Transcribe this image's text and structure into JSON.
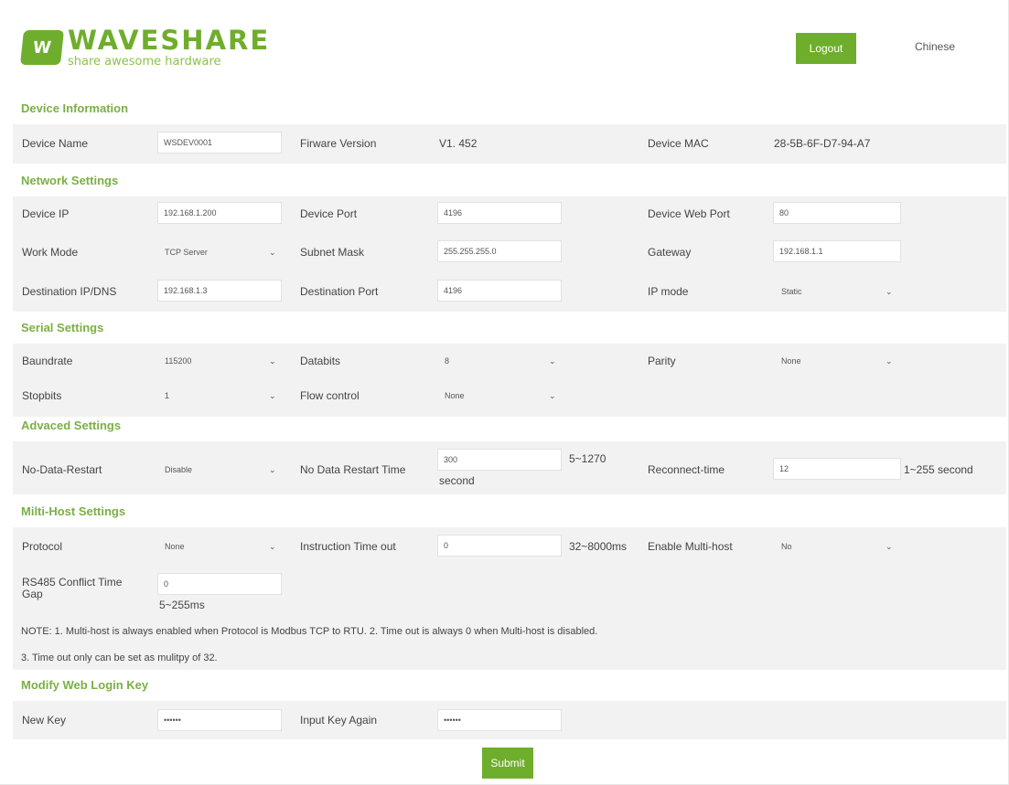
{
  "header": {
    "logo_mark": "W",
    "logo_name": "WAVESHARE",
    "logo_tagline": "share awesome hardware",
    "logout_label": "Logout",
    "language_label": "Chinese",
    "accent_color": "#6fae2c"
  },
  "device_info": {
    "title": "Device Information",
    "device_name_label": "Device Name",
    "device_name_value": "WSDEV0001",
    "firmware_label": "Firware Version",
    "firmware_value": "V1. 452",
    "mac_label": "Device MAC",
    "mac_value": "28-5B-6F-D7-94-A7"
  },
  "network": {
    "title": "Network Settings",
    "device_ip_label": "Device IP",
    "device_ip_value": "192.168.1.200",
    "device_port_label": "Device Port",
    "device_port_value": "4196",
    "web_port_label": "Device Web Port",
    "web_port_value": "80",
    "work_mode_label": "Work Mode",
    "work_mode_value": "TCP Server",
    "subnet_label": "Subnet Mask",
    "subnet_value": "255.255.255.0",
    "gateway_label": "Gateway",
    "gateway_value": "192.168.1.1",
    "dest_ip_label": "Destination IP/DNS",
    "dest_ip_value": "192.168.1.3",
    "dest_port_label": "Destination Port",
    "dest_port_value": "4196",
    "ip_mode_label": "IP mode",
    "ip_mode_value": "Static"
  },
  "serial": {
    "title": "Serial Settings",
    "baud_label": "Baundrate",
    "baud_value": "115200",
    "databits_label": "Databits",
    "databits_value": "8",
    "parity_label": "Parity",
    "parity_value": "None",
    "stopbits_label": "Stopbits",
    "stopbits_value": "1",
    "flow_label": "Flow control",
    "flow_value": "None"
  },
  "advanced": {
    "title": "Advaced Settings",
    "restart_label": "No-Data-Restart",
    "restart_value": "Disable",
    "restart_time_label": "No Data Restart Time",
    "restart_time_value": "300",
    "restart_time_range": "5~1270",
    "restart_time_unit": "second",
    "reconnect_label": "Reconnect-time",
    "reconnect_value": "12",
    "reconnect_hint": "1~255 second"
  },
  "multihost": {
    "title": "Milti-Host Settings",
    "protocol_label": "Protocol",
    "protocol_value": "None",
    "timeout_label": "Instruction Time out",
    "timeout_value": "0",
    "timeout_hint": "32~8000ms",
    "enable_label": "Enable Multi-host",
    "enable_value": "No",
    "conflict_label": "RS485 Conflict Time Gap",
    "conflict_value": "0",
    "conflict_hint": "5~255ms",
    "note_1": "NOTE: 1. Multi-host is always enabled when Protocol is Modbus TCP to RTU. 2. Time out is always 0 when Multi-host is disabled.",
    "note_2": "3. Time out only can be set as mulitpy of 32."
  },
  "login_key": {
    "title": "Modify Web Login Key",
    "new_key_label": "New Key",
    "new_key_value": "******",
    "again_label": "Input Key Again",
    "again_value": "******"
  },
  "submit_label": "Submit"
}
